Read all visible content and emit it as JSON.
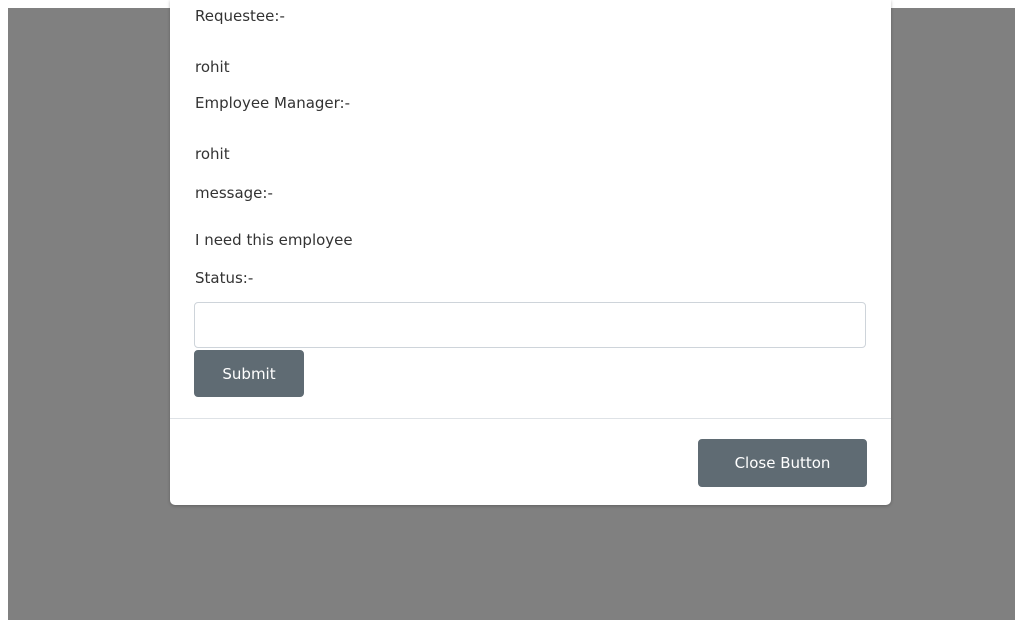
{
  "modal": {
    "fields": {
      "requestee_label": "Requestee:-",
      "requestee_value": "rohit",
      "manager_label": "Employee Manager:-",
      "manager_value": "rohit",
      "message_label": "message:-",
      "message_value": "I need this employee",
      "status_label": "Status:-",
      "status_value": ""
    },
    "submit_label": "Submit",
    "close_label": "Close Button"
  },
  "colors": {
    "backdrop": "#808080",
    "button": "#5f6b73",
    "modal_background": "#ffffff"
  }
}
